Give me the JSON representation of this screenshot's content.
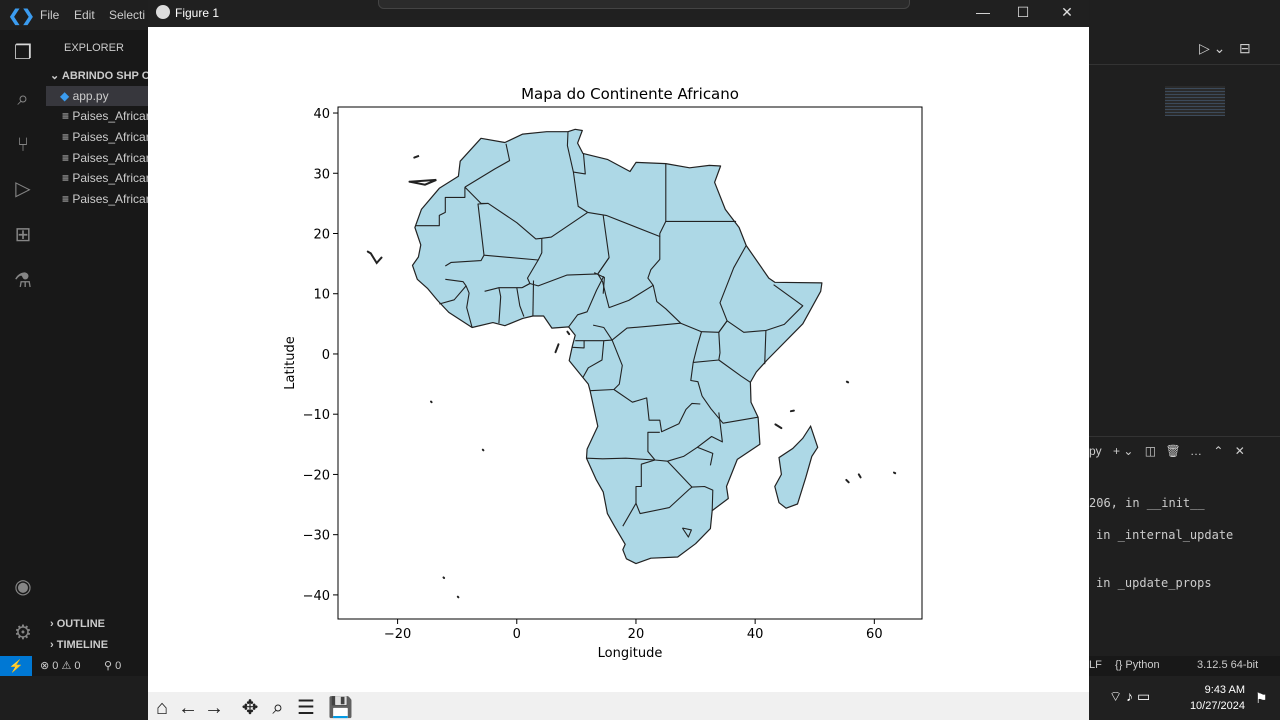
{
  "vscode": {
    "menu": [
      "File",
      "Edit",
      "Selecti"
    ],
    "explorer_label": "EXPLORER",
    "folder_name": "ABRINDO SHP OL",
    "files": [
      "app.py",
      "Paises_Africar",
      "Paises_Africar",
      "Paises_Africar",
      "Paises_Africar",
      "Paises_Africar"
    ],
    "outline_label": "OUTLINE",
    "timeline_label": "TIMELINE",
    "status": {
      "errors": "0",
      "warnings": "0",
      "ports": "0"
    },
    "terminal_lines": [
      "206, in __init__",
      "in _internal_update",
      "in _update_props"
    ],
    "terminal_tab": "py",
    "status_right": {
      "eol": "LF",
      "lang": "{} Python",
      "version": "3.12.5 64-bit"
    },
    "clock": {
      "time": "9:43 AM",
      "date": "10/27/2024"
    }
  },
  "figure": {
    "window_title": "Figure 1",
    "toolbar_icons": [
      "home-icon",
      "back-arrow-icon",
      "forward-arrow-icon",
      "pan-icon",
      "zoom-icon",
      "configure-icon",
      "save-icon"
    ]
  },
  "chart_data": {
    "type": "map",
    "title": "Mapa do Continente Africano",
    "xlabel": "Longitude",
    "ylabel": "Latitude",
    "xlim": [
      -30,
      68
    ],
    "ylim": [
      -44,
      41
    ],
    "xticks": [
      -20,
      0,
      20,
      40,
      60
    ],
    "yticks": [
      -40,
      -30,
      -20,
      -10,
      0,
      10,
      20,
      30,
      40
    ],
    "fill_color": "#add8e6",
    "edge_color": "#222222",
    "continent_outline": [
      [
        -17.1,
        21
      ],
      [
        -16,
        24
      ],
      [
        -13,
        27.5
      ],
      [
        -9.8,
        29.5
      ],
      [
        -9.5,
        32
      ],
      [
        -6,
        35.8
      ],
      [
        -2,
        35.1
      ],
      [
        1,
        36.5
      ],
      [
        5,
        36.9
      ],
      [
        8.6,
        36.9
      ],
      [
        9.8,
        37.3
      ],
      [
        11,
        37.1
      ],
      [
        10.2,
        35
      ],
      [
        11.1,
        33.3
      ],
      [
        15.2,
        32.3
      ],
      [
        19,
        30.3
      ],
      [
        20,
        31.8
      ],
      [
        25,
        31.6
      ],
      [
        29,
        30.9
      ],
      [
        32.3,
        31.3
      ],
      [
        34.2,
        31.2
      ],
      [
        33.2,
        28.5
      ],
      [
        35,
        24
      ],
      [
        37.3,
        21
      ],
      [
        38.5,
        18
      ],
      [
        42.3,
        12.6
      ],
      [
        43.3,
        11.9
      ],
      [
        51.2,
        11.8
      ],
      [
        51,
        10.4
      ],
      [
        48,
        5
      ],
      [
        42,
        -1
      ],
      [
        40.2,
        -3
      ],
      [
        39.2,
        -4.7
      ],
      [
        39.3,
        -8
      ],
      [
        40.5,
        -10.5
      ],
      [
        40.8,
        -15
      ],
      [
        37,
        -17.5
      ],
      [
        35.2,
        -22
      ],
      [
        35.5,
        -24
      ],
      [
        32.8,
        -26
      ],
      [
        32.5,
        -29
      ],
      [
        30,
        -31.5
      ],
      [
        27,
        -33.7
      ],
      [
        22.5,
        -33.9
      ],
      [
        20,
        -34.8
      ],
      [
        18.4,
        -34
      ],
      [
        17.8,
        -32.5
      ],
      [
        18.2,
        -31.6
      ],
      [
        16.4,
        -28.6
      ],
      [
        15.2,
        -26.5
      ],
      [
        14.5,
        -22.9
      ],
      [
        13.3,
        -20.8
      ],
      [
        11.7,
        -17.3
      ],
      [
        11.8,
        -15.8
      ],
      [
        13.6,
        -12
      ],
      [
        12.3,
        -6.1
      ],
      [
        12,
        -5
      ],
      [
        11.1,
        -3.9
      ],
      [
        8.8,
        -1.1
      ],
      [
        9.3,
        1.2
      ],
      [
        9.8,
        3.1
      ],
      [
        8.7,
        4.5
      ],
      [
        5.9,
        4.3
      ],
      [
        4.5,
        6.3
      ],
      [
        2.7,
        6.3
      ],
      [
        1,
        5.9
      ],
      [
        -2,
        4.7
      ],
      [
        -4,
        5.2
      ],
      [
        -7.5,
        4.4
      ],
      [
        -11.4,
        6.9
      ],
      [
        -13.3,
        8.9
      ],
      [
        -15,
        10.9
      ],
      [
        -16.7,
        12.4
      ],
      [
        -17.5,
        14.7
      ],
      [
        -16.5,
        16.1
      ],
      [
        -16.1,
        18.1
      ],
      [
        -17.1,
        21
      ]
    ],
    "madagascar_outline": [
      [
        49.3,
        -12
      ],
      [
        50.5,
        -15.5
      ],
      [
        49.5,
        -17
      ],
      [
        48.5,
        -20.5
      ],
      [
        47.1,
        -24.9
      ],
      [
        45.2,
        -25.6
      ],
      [
        44,
        -24.7
      ],
      [
        43.3,
        -22
      ],
      [
        44.4,
        -20
      ],
      [
        44,
        -17.2
      ],
      [
        46.3,
        -15.7
      ],
      [
        48,
        -14
      ],
      [
        49.3,
        -12
      ]
    ],
    "borders": [
      [
        [
          -17,
          21.3
        ],
        [
          -13,
          21.3
        ],
        [
          -13,
          23
        ],
        [
          -12,
          23.5
        ],
        [
          -12,
          26
        ],
        [
          -8.7,
          26
        ],
        [
          -8.7,
          27.7
        ]
      ],
      [
        [
          -8.7,
          27.7
        ],
        [
          -3.7,
          30.7
        ],
        [
          -1.2,
          32.1
        ],
        [
          -1.8,
          34.9
        ]
      ],
      [
        [
          8.6,
          36.9
        ],
        [
          8.5,
          34.6
        ],
        [
          9.5,
          30.2
        ],
        [
          10.3,
          24.5
        ],
        [
          11.9,
          23.5
        ]
      ],
      [
        [
          9.5,
          30.2
        ],
        [
          11.5,
          29.9
        ],
        [
          11.2,
          33.2
        ]
      ],
      [
        [
          -8.7,
          27.7
        ],
        [
          -6,
          25
        ],
        [
          -4.8,
          25
        ],
        [
          0,
          21.8
        ],
        [
          3.2,
          19.1
        ],
        [
          4.2,
          19.2
        ],
        [
          5.8,
          19.4
        ],
        [
          11.9,
          23.5
        ]
      ],
      [
        [
          11.9,
          23.5
        ],
        [
          15,
          23
        ],
        [
          24,
          19.5
        ],
        [
          24,
          15.7
        ],
        [
          22.5,
          14
        ],
        [
          22,
          12.6
        ],
        [
          22.9,
          11.4
        ],
        [
          23.5,
          8.7
        ],
        [
          25,
          7.5
        ],
        [
          27.5,
          5.1
        ],
        [
          31,
          3.7
        ],
        [
          33.9,
          3.6
        ],
        [
          35.3,
          5.5
        ],
        [
          34.1,
          8.5
        ],
        [
          36.4,
          14.3
        ],
        [
          38.5,
          18
        ]
      ],
      [
        [
          24,
          19.5
        ],
        [
          24,
          20
        ],
        [
          25,
          22
        ],
        [
          36.8,
          22
        ]
      ],
      [
        [
          25,
          22
        ],
        [
          25,
          29.2
        ],
        [
          25,
          31.6
        ]
      ],
      [
        [
          -12,
          14.6
        ],
        [
          -11,
          15.2
        ],
        [
          -6,
          15.5
        ],
        [
          -5.5,
          16.4
        ],
        [
          -6.5,
          24.9
        ],
        [
          -4.8,
          25
        ]
      ],
      [
        [
          -5.5,
          16.4
        ],
        [
          3.6,
          15.6
        ],
        [
          4.2,
          16.8
        ],
        [
          4.2,
          19.2
        ]
      ],
      [
        [
          3.6,
          15.6
        ],
        [
          1.8,
          12.6
        ],
        [
          2.2,
          11.7
        ],
        [
          0.9,
          11
        ]
      ],
      [
        [
          -5.4,
          10.4
        ],
        [
          -3,
          11
        ],
        [
          0.9,
          11
        ],
        [
          2.2,
          11.7
        ],
        [
          3.6,
          11.3
        ],
        [
          8.4,
          13.1
        ],
        [
          13.6,
          13.3
        ],
        [
          15.5,
          16
        ]
      ],
      [
        [
          14.5,
          23
        ],
        [
          15.5,
          16
        ],
        [
          13.6,
          13.3
        ],
        [
          14.4,
          12
        ],
        [
          14.9,
          9.9
        ],
        [
          15.5,
          7.7
        ],
        [
          18.8,
          8.9
        ],
        [
          22.9,
          11.4
        ]
      ],
      [
        [
          12.8,
          4.8
        ],
        [
          14.6,
          4.4
        ],
        [
          16,
          2.3
        ],
        [
          18.5,
          4.3
        ],
        [
          22,
          4.6
        ],
        [
          27.5,
          5.1
        ]
      ],
      [
        [
          14.5,
          10
        ],
        [
          14.7,
          12.7
        ],
        [
          13,
          13.5
        ]
      ],
      [
        [
          -12,
          12.4
        ],
        [
          -9,
          12
        ],
        [
          -8.5,
          11.3
        ],
        [
          -10.5,
          9
        ],
        [
          -13,
          8.3
        ]
      ],
      [
        [
          -8.5,
          11.3
        ],
        [
          -8,
          10.1
        ],
        [
          -8.4,
          7.7
        ],
        [
          -7.5,
          4.4
        ]
      ],
      [
        [
          -3,
          11
        ],
        [
          -2.7,
          9.5
        ],
        [
          -3,
          5.1
        ]
      ],
      [
        [
          0,
          11
        ],
        [
          0.5,
          8
        ],
        [
          1.2,
          6.2
        ]
      ],
      [
        [
          2.7,
          6.3
        ],
        [
          2.8,
          12.2
        ]
      ],
      [
        [
          8.7,
          4.5
        ],
        [
          10.2,
          6.5
        ],
        [
          11.8,
          7
        ],
        [
          13.4,
          10.6
        ],
        [
          14.6,
          12.9
        ]
      ],
      [
        [
          9.8,
          2.2
        ],
        [
          11.3,
          2.2
        ],
        [
          11.3,
          1
        ],
        [
          9.3,
          1.1
        ]
      ],
      [
        [
          11.3,
          2.2
        ],
        [
          14.6,
          2.2
        ],
        [
          16,
          2.3
        ]
      ],
      [
        [
          14.6,
          2.2
        ],
        [
          14.3,
          -1
        ],
        [
          12,
          -2.3
        ],
        [
          11.1,
          -3.9
        ]
      ],
      [
        [
          16,
          2.3
        ],
        [
          17.7,
          -1.9
        ],
        [
          17.2,
          -5
        ],
        [
          16.3,
          -5.9
        ],
        [
          12.3,
          -6.1
        ]
      ],
      [
        [
          16.3,
          -5.9
        ],
        [
          19.4,
          -8
        ],
        [
          21.8,
          -7.3
        ],
        [
          22.2,
          -11
        ],
        [
          24,
          -11
        ],
        [
          24.3,
          -12.9
        ],
        [
          27.2,
          -11.6
        ],
        [
          28.4,
          -9.2
        ],
        [
          29.4,
          -8.2
        ],
        [
          30.8,
          -8.3
        ]
      ],
      [
        [
          31,
          3.7
        ],
        [
          30.3,
          1.3
        ],
        [
          29.6,
          -1.4
        ],
        [
          29.2,
          -4.4
        ],
        [
          30.4,
          -4.6
        ],
        [
          31.1,
          -7
        ]
      ],
      [
        [
          29.6,
          -1.4
        ],
        [
          33.9,
          -1
        ],
        [
          34.1,
          0.2
        ],
        [
          33.9,
          3.6
        ]
      ],
      [
        [
          33.9,
          -1
        ],
        [
          37.7,
          -3.7
        ],
        [
          39.2,
          -4.7
        ]
      ],
      [
        [
          33.9,
          3.6
        ],
        [
          35.3,
          5.5
        ],
        [
          38.1,
          3.6
        ],
        [
          41.8,
          3.9
        ],
        [
          41.6,
          -1.7
        ]
      ],
      [
        [
          41.8,
          3.9
        ],
        [
          44.9,
          4.9
        ],
        [
          48,
          8
        ],
        [
          43.1,
          11.5
        ]
      ],
      [
        [
          31.1,
          -7
        ],
        [
          32.6,
          -9.1
        ],
        [
          34.6,
          -11.5
        ],
        [
          40.5,
          -10.5
        ]
      ],
      [
        [
          33.9,
          -9.7
        ],
        [
          34.5,
          -14.6
        ],
        [
          32.7,
          -13.7
        ],
        [
          30.3,
          -15.5
        ],
        [
          28,
          -17
        ],
        [
          25.3,
          -17.8
        ],
        [
          23.2,
          -17.6
        ],
        [
          22,
          -16.2
        ],
        [
          22,
          -13
        ],
        [
          24,
          -13
        ]
      ],
      [
        [
          23.2,
          -17.6
        ],
        [
          20.9,
          -18.3
        ],
        [
          20.9,
          -22
        ],
        [
          20,
          -22
        ],
        [
          20,
          -24.8
        ],
        [
          17.8,
          -28.6
        ]
      ],
      [
        [
          11.7,
          -17.3
        ],
        [
          14.4,
          -17.4
        ],
        [
          18.3,
          -17.3
        ],
        [
          23.2,
          -17.6
        ]
      ],
      [
        [
          25.3,
          -17.8
        ],
        [
          29.4,
          -22.1
        ],
        [
          31.5,
          -22
        ],
        [
          32.9,
          -22.6
        ],
        [
          32.8,
          -26
        ]
      ],
      [
        [
          20,
          -24.8
        ],
        [
          20.7,
          -26.5
        ],
        [
          25.6,
          -25.5
        ],
        [
          28.9,
          -22.5
        ],
        [
          29.4,
          -22.1
        ]
      ],
      [
        [
          32.5,
          -18.5
        ],
        [
          32.9,
          -16.5
        ],
        [
          30.3,
          -15.5
        ]
      ],
      [
        [
          27.8,
          -28.9
        ],
        [
          28.8,
          -30.4
        ],
        [
          29.3,
          -29.2
        ],
        [
          27.8,
          -28.9
        ]
      ]
    ],
    "islands": [
      [
        [
          -17.2,
          32.6
        ],
        [
          -16.4,
          32.9
        ],
        [
          -17.2,
          32.6
        ]
      ],
      [
        [
          -18,
          28.6
        ],
        [
          -15.4,
          28.1
        ],
        [
          -13.5,
          28.9
        ],
        [
          -18,
          28.6
        ]
      ],
      [
        [
          -25,
          17
        ],
        [
          -24.5,
          16.7
        ],
        [
          -23.5,
          15.1
        ],
        [
          -22.7,
          16
        ]
      ],
      [
        [
          6.5,
          0.3
        ],
        [
          7,
          1.6
        ]
      ],
      [
        [
          8.5,
          3.7
        ],
        [
          8.8,
          3.3
        ]
      ],
      [
        [
          43.4,
          -11.7
        ],
        [
          44.4,
          -12.3
        ]
      ],
      [
        [
          55.3,
          -20.9
        ],
        [
          55.7,
          -21.3
        ]
      ],
      [
        [
          57.4,
          -20
        ],
        [
          57.7,
          -20.5
        ]
      ],
      [
        [
          63.3,
          -19.7
        ],
        [
          63.5,
          -19.8
        ]
      ],
      [
        [
          55.4,
          -4.6
        ],
        [
          55.6,
          -4.7
        ]
      ],
      [
        [
          46,
          -9.5
        ],
        [
          46.5,
          -9.4
        ]
      ],
      [
        [
          -14.4,
          -7.9
        ],
        [
          -14.3,
          -8
        ]
      ],
      [
        [
          -5.7,
          -15.9
        ],
        [
          -5.6,
          -16
        ]
      ],
      [
        [
          -12.3,
          -37.1
        ],
        [
          -12.2,
          -37.2
        ]
      ],
      [
        [
          -9.9,
          -40.3
        ],
        [
          -9.8,
          -40.4
        ]
      ]
    ]
  }
}
